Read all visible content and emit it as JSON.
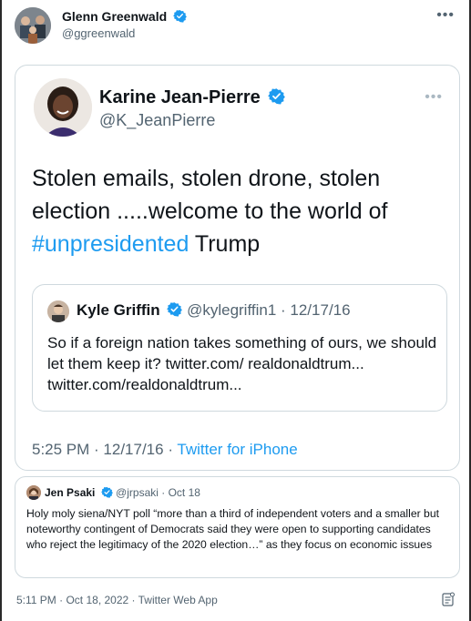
{
  "tweet": {
    "author_name": "Glenn Greenwald",
    "author_handle": "@ggreenwald",
    "more_label": "•••",
    "timestamp": "5:11 PM · Oct 18, 2022 · Twitter Web App"
  },
  "screenshot": {
    "author_name": "Karine Jean-Pierre",
    "author_handle": "@K_JeanPierre",
    "more_label": "•••",
    "text_before_hashtag": "Stolen emails, stolen drone, stolen election .....welcome to the world of ",
    "hashtag": "#unpresidented",
    "text_after_hashtag": " Trump",
    "timestamp": "5:25 PM · 12/17/16 · ",
    "source": "Twitter for iPhone",
    "quoted": {
      "author_name": "Kyle Griffin",
      "meta": " @kylegriffin1 · 12/17/16",
      "text": "So if a foreign nation takes something of ours, we should let them keep it? twitter.com/ realdonaldtrum... twitter.com/realdonaldtrum..."
    }
  },
  "psaki_quote": {
    "author_name": "Jen Psaki",
    "meta": " @jrpsaki · Oct 18",
    "text": "Holy moly siena/NYT poll “more than a third of independent voters and a smaller but noteworthy contingent of Democrats said they were open to supporting candidates who reject the legitimacy of the  2020 election…” as they focus on economic issues"
  },
  "colors": {
    "verified": "#1d9bf0",
    "link": "#1d9bf0",
    "secondary_text": "#536471",
    "border": "#cfd9de"
  },
  "icons": [
    "verified-badge-icon",
    "more-options-icon",
    "analytics-icon"
  ]
}
